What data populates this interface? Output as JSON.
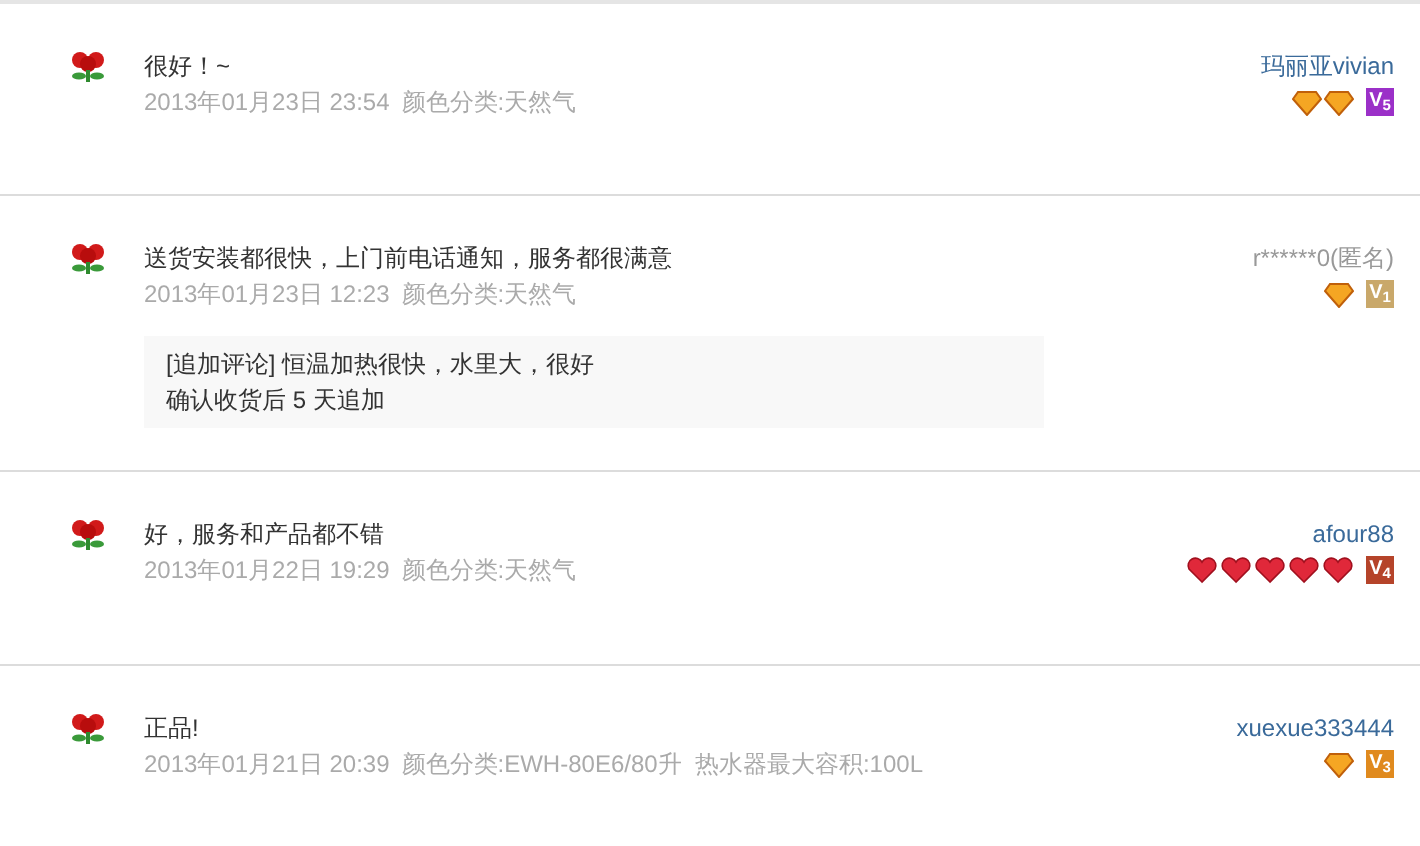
{
  "reviews": [
    {
      "comment": "很好！~",
      "date": "2013年01月23日 23:54",
      "sku": "颜色分类:天然气",
      "reviewer": "玛丽亚vivian",
      "anonymous": false,
      "credit_icons": [
        {
          "kind": "diamond"
        },
        {
          "kind": "diamond"
        }
      ],
      "vip": {
        "label": "V$_{5}$",
        "color": "#9b30c8"
      }
    },
    {
      "comment": "送货安装都很快，上门前电话通知，服务都很满意",
      "date": "2013年01月23日 12:23",
      "sku": "颜色分类:天然气",
      "reviewer": "r******0(匿名)",
      "anonymous": true,
      "credit_icons": [
        {
          "kind": "diamond"
        }
      ],
      "vip": {
        "label": "V$_{1}$",
        "color": "#c9a86a"
      },
      "followup": {
        "text": "[追加评论] 恒温加热很快，水里大，很好",
        "note": "确认收货后 5 天追加"
      }
    },
    {
      "comment": "好，服务和产品都不错",
      "date": "2013年01月22日 19:29",
      "sku": "颜色分类:天然气",
      "reviewer": "afour88",
      "anonymous": false,
      "credit_icons": [
        {
          "kind": "heart"
        },
        {
          "kind": "heart"
        },
        {
          "kind": "heart"
        },
        {
          "kind": "heart"
        },
        {
          "kind": "heart"
        }
      ],
      "vip": {
        "label": "V$_{4}$",
        "color": "#b5442a"
      }
    },
    {
      "comment": "正品!",
      "date": "2013年01月21日 20:39",
      "sku": "颜色分类:EWH-80E6/80升  热水器最大容积:100L",
      "reviewer": "xuexue333444",
      "anonymous": false,
      "credit_icons": [
        {
          "kind": "diamond"
        }
      ],
      "vip": {
        "label": "V$_{3}$",
        "color": "#e08a1e"
      }
    }
  ]
}
